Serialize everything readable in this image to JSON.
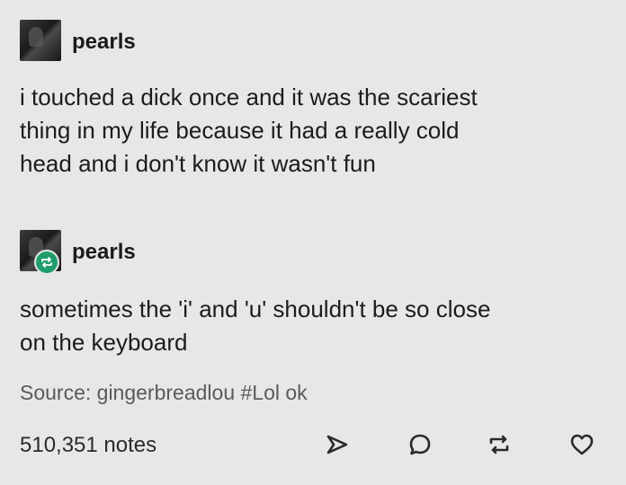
{
  "post": {
    "username": "pearls",
    "text": "i touched a dick once and it was the scariest\nthing in my life because it had a really cold\nhead and i don't know it wasn't fun"
  },
  "reply": {
    "username": "pearls",
    "text": "sometimes the 'i' and 'u' shouldn't be so close\non the keyboard"
  },
  "footer": {
    "source_label": "Source:",
    "source_name": "gingerbreadlou",
    "tags": "#Lol ok",
    "notes": "510,351 notes"
  },
  "icons": {
    "reblog_badge": "reblog-icon",
    "share": "send-icon",
    "reply": "comment-icon",
    "reblog": "reblog-icon",
    "like": "heart-icon"
  },
  "colors": {
    "background": "#e7e7e7",
    "reblog_badge": "#1f9d6a"
  }
}
